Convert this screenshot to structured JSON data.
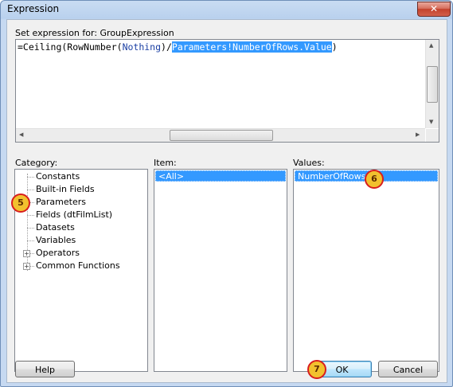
{
  "window": {
    "title": "Expression",
    "close_glyph": "✕"
  },
  "expression": {
    "label": "Set expression for: GroupExpression",
    "code_prefix": "=Ceiling(RowNumber(",
    "code_keyword": "Nothing",
    "code_mid": ")/",
    "code_selected": "Parameters!NumberOfRows.Value",
    "code_suffix": ")"
  },
  "category": {
    "label": "Category:",
    "items": [
      "Constants",
      "Built-in Fields",
      "Parameters",
      "Fields (dtFilmList)",
      "Datasets",
      "Variables",
      "Operators",
      "Common Functions"
    ],
    "expanders": [
      "+",
      "+"
    ]
  },
  "item": {
    "label": "Item:",
    "selected": "<All>"
  },
  "values": {
    "label": "Values:",
    "selected": "NumberOfRows"
  },
  "buttons": {
    "help": "Help",
    "ok": "OK",
    "cancel": "Cancel"
  },
  "annotations": [
    "5",
    "6",
    "7"
  ],
  "colors": {
    "selection": "#3399ff",
    "badge_fill": "#f2c12e",
    "badge_border": "#d81d1d",
    "keyword": "#1a3fa3"
  },
  "scroll_arrows": {
    "up": "▲",
    "down": "▼",
    "left": "◀",
    "right": "▶"
  }
}
